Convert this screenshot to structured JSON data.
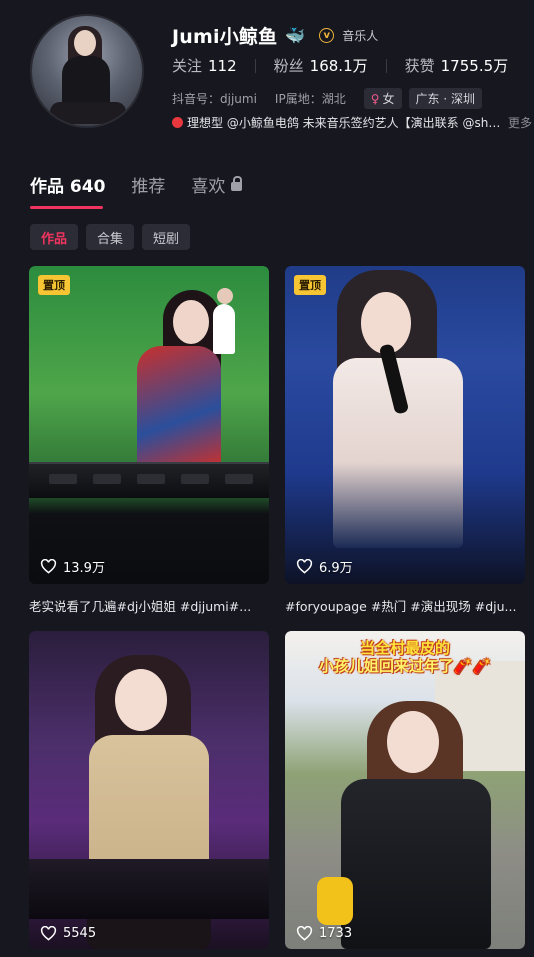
{
  "profile": {
    "name": "Jumi小鲸鱼",
    "name_icon": "whale-emoji-icon",
    "role": "音乐人",
    "stats": [
      {
        "label": "关注",
        "value": "112"
      },
      {
        "label": "粉丝",
        "value": "168.1万"
      },
      {
        "label": "获赞",
        "value": "1755.5万"
      }
    ],
    "douyin_id": "抖音号：djjumi",
    "ip": "IP属地：湖北",
    "gender_tag": "女",
    "location_tag": "广东 · 深圳",
    "description": "理想型 @小鲸鱼电鸽 未来音乐签约艺人【演出联系 @shi...",
    "more_label": "更多"
  },
  "tabs": [
    {
      "label": "作品 640"
    },
    {
      "label": "推荐"
    },
    {
      "label": "喜欢"
    }
  ],
  "filters": [
    {
      "label": "作品"
    },
    {
      "label": "合集"
    },
    {
      "label": "短剧"
    }
  ],
  "videos": [
    {
      "pinned": "置顶",
      "likes": "13.9万",
      "caption": "老实说看了几遍#dj小姐姐 #djjumi#..."
    },
    {
      "pinned": "置顶",
      "likes": "6.9万",
      "caption": "#foryoupage #热门 #演出现场 #dju..."
    },
    {
      "pinned": "",
      "likes": "5545",
      "caption": ""
    },
    {
      "pinned": "",
      "likes": "1733",
      "caption": "",
      "overlay_line1": "当全村最皮的",
      "overlay_line2": "小孩儿姐回来过年了🧨🧨"
    }
  ],
  "colors": {
    "background": "#16171f",
    "accent": "#f0345e",
    "pinned": "#f7c433",
    "verified": "#f0b43a"
  }
}
